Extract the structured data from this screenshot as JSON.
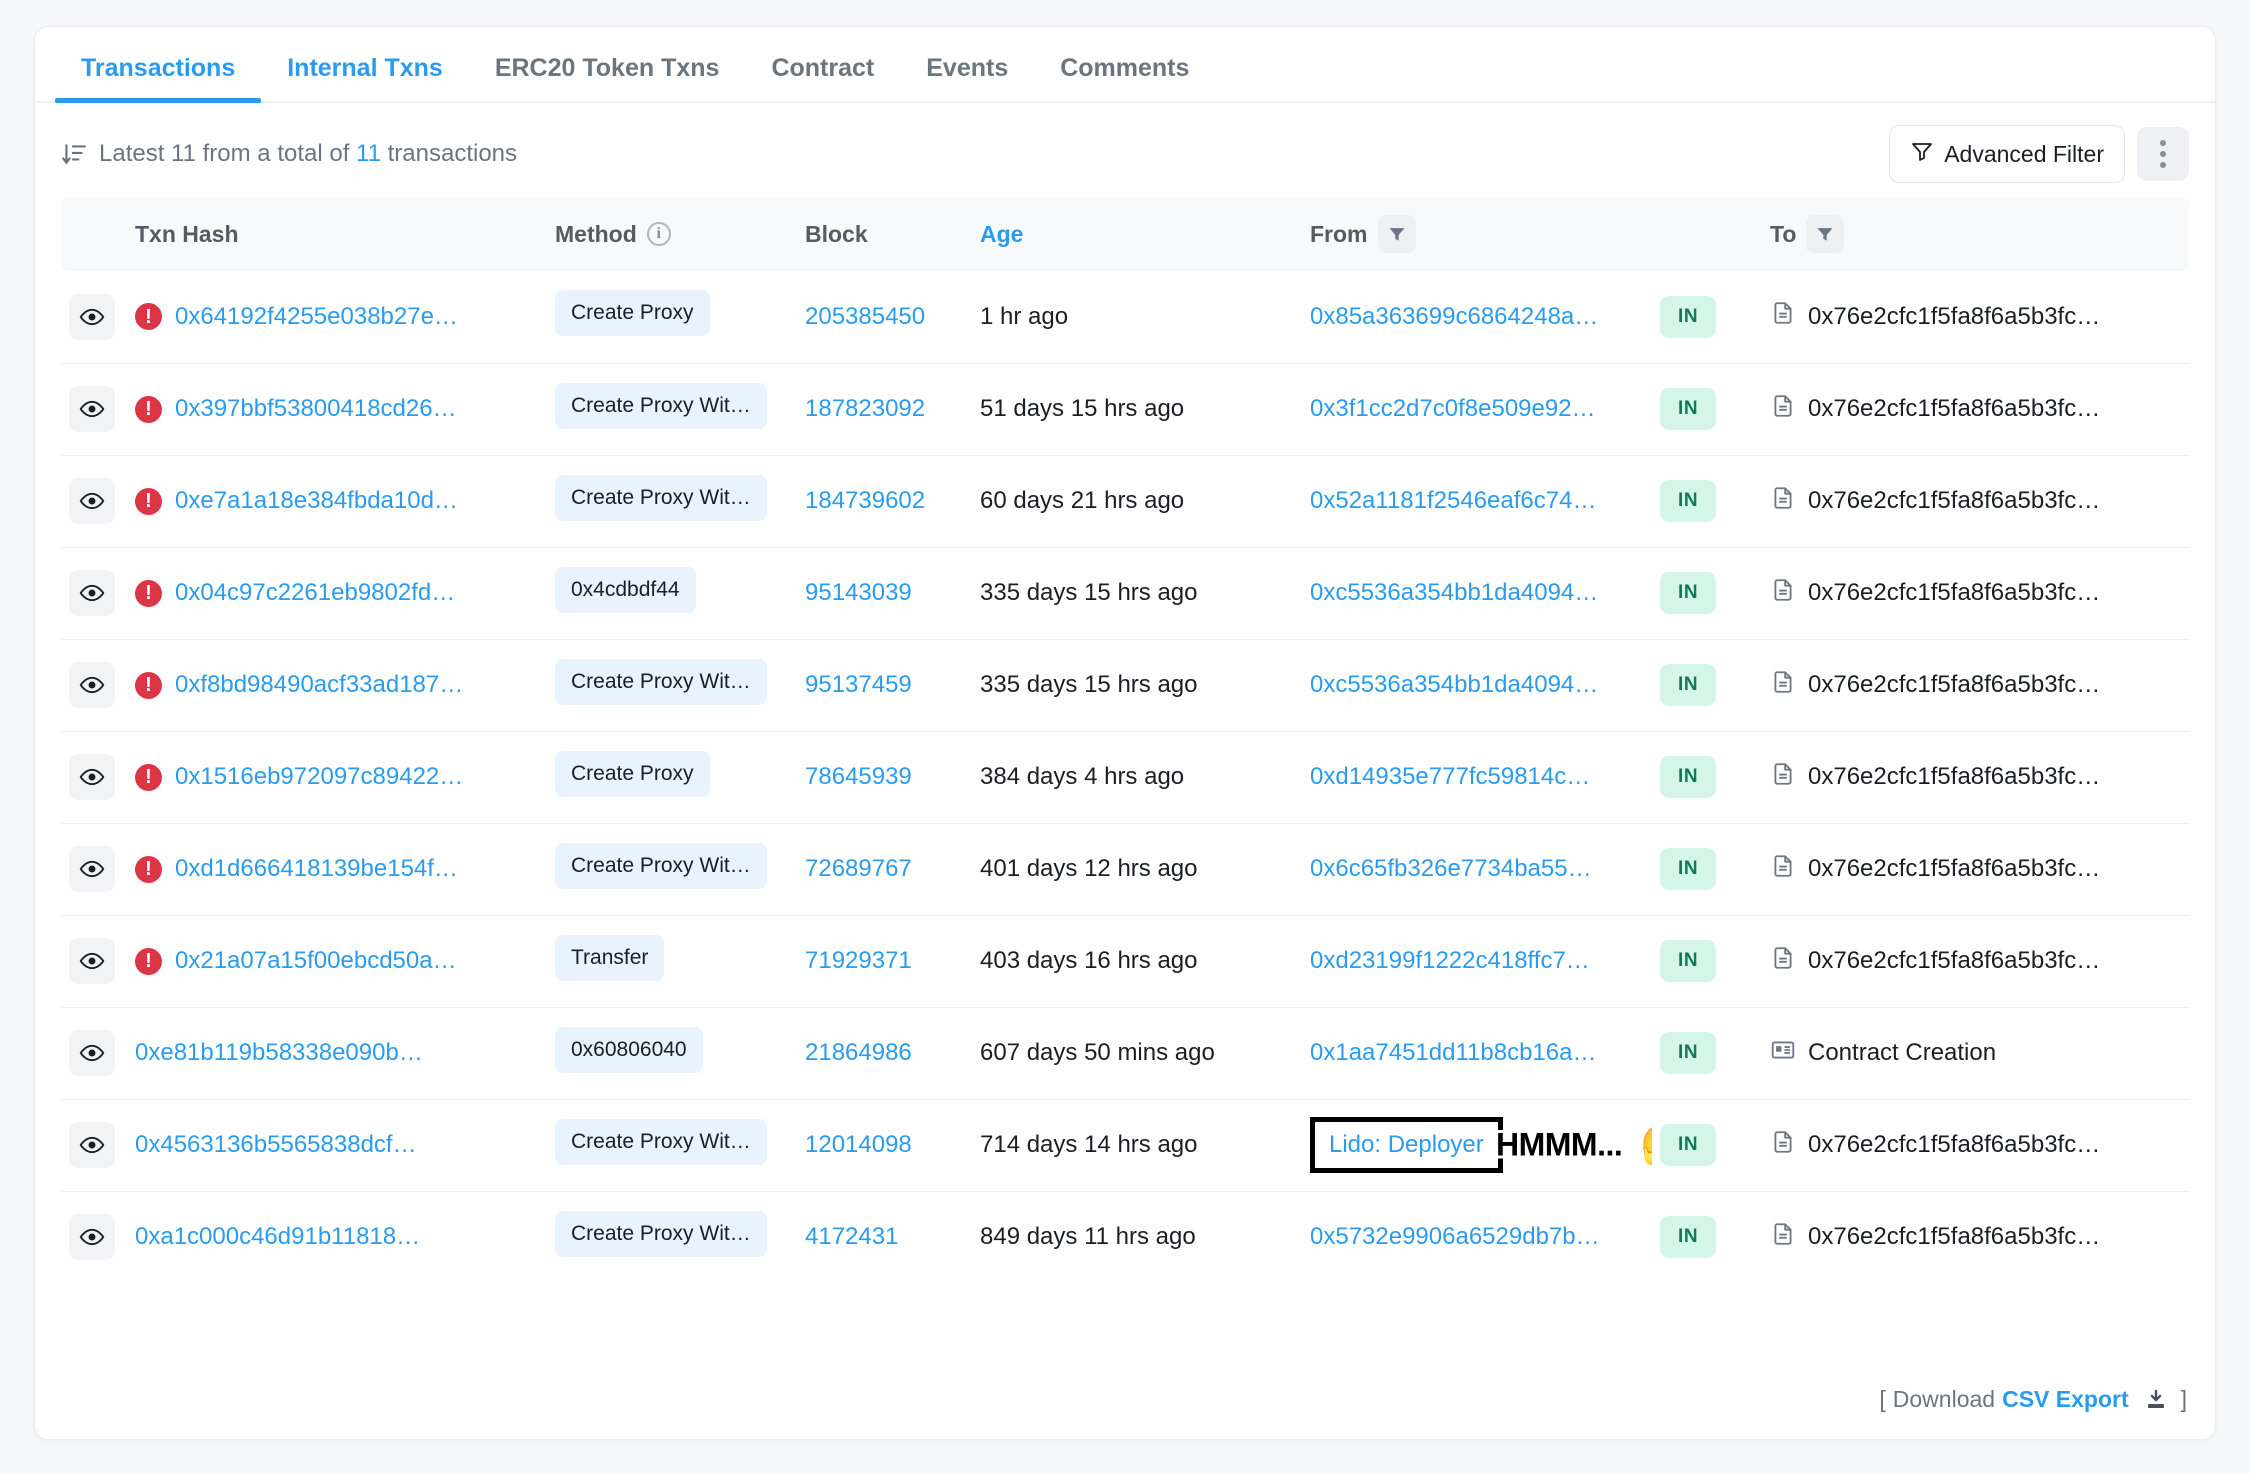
{
  "tabs": [
    {
      "label": "Transactions",
      "state": "active"
    },
    {
      "label": "Internal Txns",
      "state": "blue"
    },
    {
      "label": "ERC20 Token Txns",
      "state": "default"
    },
    {
      "label": "Contract",
      "state": "default"
    },
    {
      "label": "Events",
      "state": "default"
    },
    {
      "label": "Comments",
      "state": "default"
    }
  ],
  "subheader": {
    "sort_icon": "sort-descending-icon",
    "prefix": "Latest 11 from a total of",
    "total": "11",
    "suffix": "transactions",
    "advanced_filter_label": "Advanced Filter",
    "filter_icon": "funnel-icon",
    "more_icon": "vertical-dots-icon"
  },
  "table": {
    "headers": {
      "eye": "",
      "txn_hash": "Txn Hash",
      "method": "Method",
      "method_info_icon": "info-icon",
      "block": "Block",
      "age": "Age",
      "from": "From",
      "from_filter_icon": "funnel-filter-icon",
      "direction": "",
      "to": "To",
      "to_filter_icon": "funnel-filter-icon"
    },
    "rows": [
      {
        "eye_icon": "eye-icon",
        "error": true,
        "error_icon": "error-exclamation-icon",
        "hash": "0x64192f4255e038b27e…",
        "method": "Create Proxy",
        "block": "205385450",
        "age": "1 hr ago",
        "from": "0x85a363699c6864248a…",
        "from_highlighted": false,
        "direction": "IN",
        "to": "0x76e2cfc1f5fa8f6a5b3fc…",
        "to_icon": "contract-document-icon"
      },
      {
        "eye_icon": "eye-icon",
        "error": true,
        "error_icon": "error-exclamation-icon",
        "hash": "0x397bbf53800418cd26…",
        "method": "Create Proxy Wit…",
        "block": "187823092",
        "age": "51 days 15 hrs ago",
        "from": "0x3f1cc2d7c0f8e509e92…",
        "from_highlighted": false,
        "direction": "IN",
        "to": "0x76e2cfc1f5fa8f6a5b3fc…",
        "to_icon": "contract-document-icon"
      },
      {
        "eye_icon": "eye-icon",
        "error": true,
        "error_icon": "error-exclamation-icon",
        "hash": "0xe7a1a18e384fbda10d…",
        "method": "Create Proxy Wit…",
        "block": "184739602",
        "age": "60 days 21 hrs ago",
        "from": "0x52a1181f2546eaf6c74…",
        "from_highlighted": false,
        "direction": "IN",
        "to": "0x76e2cfc1f5fa8f6a5b3fc…",
        "to_icon": "contract-document-icon"
      },
      {
        "eye_icon": "eye-icon",
        "error": true,
        "error_icon": "error-exclamation-icon",
        "hash": "0x04c97c2261eb9802fd…",
        "method": "0x4cdbdf44",
        "block": "95143039",
        "age": "335 days 15 hrs ago",
        "from": "0xc5536a354bb1da4094…",
        "from_highlighted": false,
        "direction": "IN",
        "to": "0x76e2cfc1f5fa8f6a5b3fc…",
        "to_icon": "contract-document-icon"
      },
      {
        "eye_icon": "eye-icon",
        "error": true,
        "error_icon": "error-exclamation-icon",
        "hash": "0xf8bd98490acf33ad187…",
        "method": "Create Proxy Wit…",
        "block": "95137459",
        "age": "335 days 15 hrs ago",
        "from": "0xc5536a354bb1da4094…",
        "from_highlighted": false,
        "direction": "IN",
        "to": "0x76e2cfc1f5fa8f6a5b3fc…",
        "to_icon": "contract-document-icon"
      },
      {
        "eye_icon": "eye-icon",
        "error": true,
        "error_icon": "error-exclamation-icon",
        "hash": "0x1516eb972097c89422…",
        "method": "Create Proxy",
        "block": "78645939",
        "age": "384 days 4 hrs ago",
        "from": "0xd14935e777fc59814c…",
        "from_highlighted": false,
        "direction": "IN",
        "to": "0x76e2cfc1f5fa8f6a5b3fc…",
        "to_icon": "contract-document-icon"
      },
      {
        "eye_icon": "eye-icon",
        "error": true,
        "error_icon": "error-exclamation-icon",
        "hash": "0xd1d666418139be154f…",
        "method": "Create Proxy Wit…",
        "block": "72689767",
        "age": "401 days 12 hrs ago",
        "from": "0x6c65fb326e7734ba55…",
        "from_highlighted": false,
        "direction": "IN",
        "to": "0x76e2cfc1f5fa8f6a5b3fc…",
        "to_icon": "contract-document-icon"
      },
      {
        "eye_icon": "eye-icon",
        "error": true,
        "error_icon": "error-exclamation-icon",
        "hash": "0x21a07a15f00ebcd50a…",
        "method": "Transfer",
        "block": "71929371",
        "age": "403 days 16 hrs ago",
        "from": "0xd23199f1222c418ffc7…",
        "from_highlighted": false,
        "direction": "IN",
        "to": "0x76e2cfc1f5fa8f6a5b3fc…",
        "to_icon": "contract-document-icon"
      },
      {
        "eye_icon": "eye-icon",
        "error": false,
        "error_icon": "",
        "hash": "0xe81b119b58338e090b…",
        "method": "0x60806040",
        "block": "21864986",
        "age": "607 days 50 mins ago",
        "from": "0x1aa7451dd11b8cb16a…",
        "from_highlighted": false,
        "direction": "IN",
        "to": "Contract Creation",
        "to_icon": "contract-creation-icon"
      },
      {
        "eye_icon": "eye-icon",
        "error": false,
        "error_icon": "",
        "hash": "0x4563136b5565838dcf…",
        "method": "Create Proxy Wit…",
        "block": "12014098",
        "age": "714 days 14 hrs ago",
        "from": "Lido: Deployer",
        "from_highlighted": true,
        "direction": "IN",
        "to": "0x76e2cfc1f5fa8f6a5b3fc…",
        "to_icon": "contract-document-icon"
      },
      {
        "eye_icon": "eye-icon",
        "error": false,
        "error_icon": "",
        "hash": "0xa1c000c46d91b11818…",
        "method": "Create Proxy Wit…",
        "block": "4172431",
        "age": "849 days 11 hrs ago",
        "from": "0x5732e9906a6529db7b…",
        "from_highlighted": false,
        "direction": "IN",
        "to": "0x76e2cfc1f5fa8f6a5b3fc…",
        "to_icon": "contract-document-icon"
      }
    ]
  },
  "annotation": {
    "text": "HMMM...",
    "emoji": "🤔",
    "emoji_name": "thinking-face-emoji",
    "box_color": "#000000"
  },
  "footer": {
    "open_bracket": "[",
    "download_label": "Download",
    "csv_label": "CSV Export",
    "download_icon": "download-icon",
    "close_bracket": "]"
  },
  "colors": {
    "accent_blue": "#2a9bed",
    "error_red": "#dc3545",
    "badge_blue_bg": "#e8f3fd",
    "badge_green_bg": "#d6f5e9",
    "badge_green_text": "#0f7a5a"
  }
}
